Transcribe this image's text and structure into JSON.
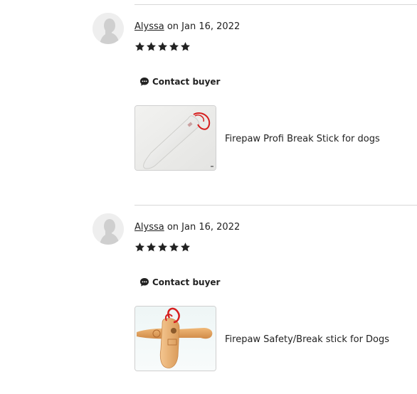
{
  "reviews": [
    {
      "reviewer": "Alyssa",
      "date_text": " on Jan 16, 2022",
      "rating": 5,
      "contact_label": "Contact buyer",
      "product_title": "Firepaw Profi Break Stick for dogs",
      "avatar_icon": "user-avatar-placeholder",
      "thumb_icon": "white-break-stick-photo"
    },
    {
      "reviewer": "Alyssa",
      "date_text": " on Jan 16, 2022",
      "rating": 5,
      "contact_label": "Contact buyer",
      "product_title": "Firepaw Safety/Break stick for Dogs",
      "avatar_icon": "user-avatar-placeholder",
      "thumb_icon": "wooden-break-stick-photo"
    }
  ],
  "colors": {
    "text": "#222222",
    "star": "#222222",
    "divider": "#d8d8d8",
    "cord_red": "#d61f1f",
    "wood": "#e0a060"
  }
}
